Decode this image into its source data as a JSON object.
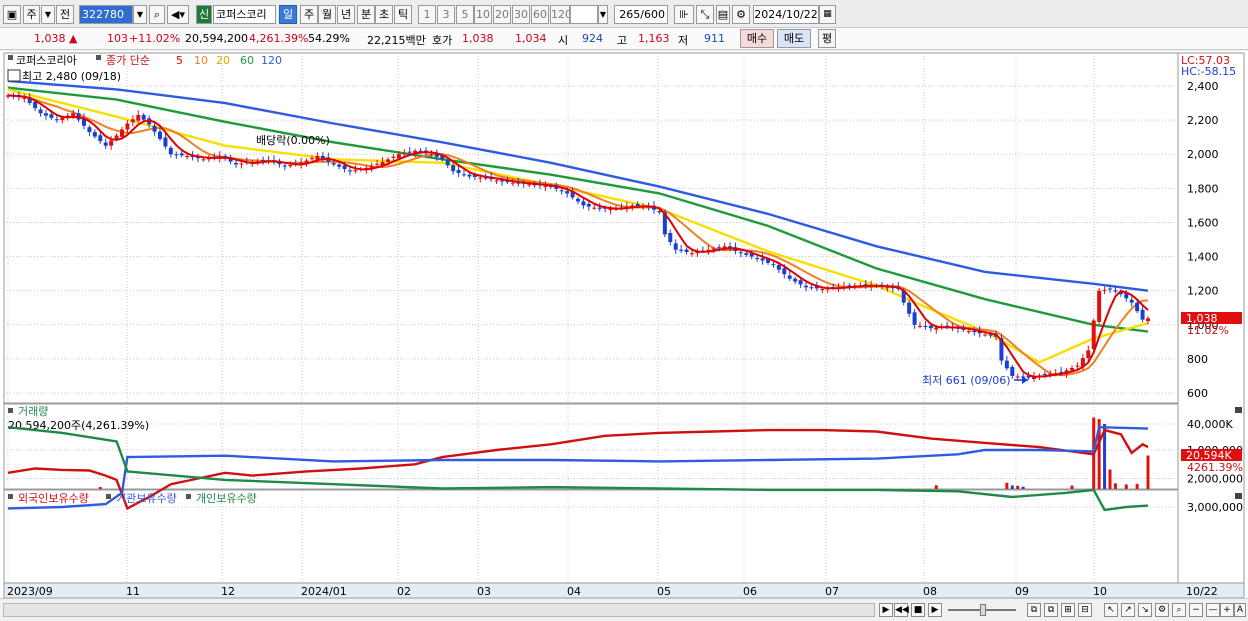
{
  "toolbar": {
    "period_day": "주",
    "prev": "전",
    "code": "322780",
    "new_badge": "신",
    "name": "코퍼스코리",
    "tabs": [
      "일",
      "주",
      "월",
      "년",
      "분",
      "초",
      "틱"
    ],
    "numbers": [
      "1",
      "3",
      "5",
      "10",
      "20",
      "30",
      "60",
      "120"
    ],
    "count": "265",
    "count_total": "/600",
    "date": "2024/10/22"
  },
  "quote": {
    "price": "1,038",
    "up_arrow": "▲",
    "change": "103",
    "change_pct": "+11.02%",
    "volume": "20,594,200",
    "volume_pct": "4,261.39%",
    "ratio": "54.29%",
    "amount": "22,215백만",
    "ask_label": "호가",
    "ask": "1,038",
    "bid": "1,034",
    "open_label": "시",
    "open": "924",
    "high_label": "고",
    "high": "1,163",
    "low_label": "저",
    "low": "911",
    "buy_button": "매수",
    "sell_button": "매도",
    "eval_button": "평"
  },
  "price_pane": {
    "legend_name": "코퍼스코리아",
    "legend_ma": "종가 단순",
    "ma_labels": [
      "5",
      "10",
      "20",
      "60",
      "120"
    ],
    "ma_colors": [
      "#e00000",
      "#f08020",
      "#f5e000",
      "#1f9a3a",
      "#2f5be0"
    ],
    "lc": "LC:57.03",
    "hc": "HC:-58.15",
    "high_note": "최고 2,480 (09/18)",
    "dividend_note": "배당락(0.00%)",
    "low_note": "최저 661 (09/06)",
    "last_price": "1,038",
    "last_pct": "11.02%"
  },
  "volume_pane": {
    "title": "거래량",
    "summary": "20,594,200주(4,261.39%)",
    "tag_value": "20,594K",
    "tag_pct": "4261.39%"
  },
  "holder_pane": {
    "legend": [
      "외국인보유수량",
      "기관보유수량",
      "개인보유수량"
    ],
    "colors": [
      "#d01010",
      "#2f5be0",
      "#1f8a48"
    ]
  },
  "x_axis": [
    "2023/09",
    "11",
    "12",
    "2024/01",
    "02",
    "03",
    "04",
    "05",
    "06",
    "07",
    "08",
    "09",
    "10"
  ],
  "x_axis_end": "10/22",
  "chart_data": [
    {
      "type": "candlestick",
      "title": "",
      "ylim": [
        560,
        2480
      ],
      "yticks": [
        600,
        800,
        1000,
        1200,
        1400,
        1600,
        1800,
        2000,
        2200,
        2400
      ],
      "ytick_labels": [
        "600",
        "800",
        "1,000",
        "1,200",
        "1,400",
        "1,600",
        "1,800",
        "2,000",
        "2,200",
        "2,400"
      ],
      "close_series": [
        [
          0,
          2345
        ],
        [
          3,
          2330
        ],
        [
          6,
          2240
        ],
        [
          9,
          2200
        ],
        [
          12,
          2240
        ],
        [
          15,
          2130
        ],
        [
          18,
          2050
        ],
        [
          20,
          2110
        ],
        [
          22,
          2180
        ],
        [
          24,
          2230
        ],
        [
          26,
          2175
        ],
        [
          28,
          2090
        ],
        [
          30,
          2000
        ],
        [
          33,
          1990
        ],
        [
          36,
          1970
        ],
        [
          39,
          1990
        ],
        [
          42,
          1940
        ],
        [
          45,
          1955
        ],
        [
          48,
          1965
        ],
        [
          51,
          1930
        ],
        [
          54,
          1950
        ],
        [
          57,
          1990
        ],
        [
          60,
          1940
        ],
        [
          63,
          1900
        ],
        [
          66,
          1920
        ],
        [
          69,
          1955
        ],
        [
          72,
          2000
        ],
        [
          75,
          2020
        ],
        [
          78,
          2000
        ],
        [
          80,
          1970
        ],
        [
          82,
          1900
        ],
        [
          85,
          1870
        ],
        [
          88,
          1860
        ],
        [
          91,
          1840
        ],
        [
          94,
          1830
        ],
        [
          97,
          1820
        ],
        [
          100,
          1810
        ],
        [
          103,
          1770
        ],
        [
          106,
          1700
        ],
        [
          109,
          1680
        ],
        [
          112,
          1680
        ],
        [
          115,
          1700
        ],
        [
          118,
          1690
        ],
        [
          120,
          1660
        ],
        [
          121,
          1530
        ],
        [
          123,
          1440
        ],
        [
          126,
          1420
        ],
        [
          129,
          1440
        ],
        [
          132,
          1460
        ],
        [
          135,
          1420
        ],
        [
          138,
          1390
        ],
        [
          141,
          1350
        ],
        [
          144,
          1270
        ],
        [
          147,
          1220
        ],
        [
          150,
          1210
        ],
        [
          153,
          1220
        ],
        [
          156,
          1230
        ],
        [
          159,
          1230
        ],
        [
          162,
          1220
        ],
        [
          164,
          1210
        ],
        [
          165,
          1130
        ],
        [
          167,
          1000
        ],
        [
          170,
          980
        ],
        [
          173,
          990
        ],
        [
          176,
          970
        ],
        [
          179,
          950
        ],
        [
          182,
          930
        ],
        [
          183,
          790
        ],
        [
          185,
          700
        ],
        [
          188,
          690
        ],
        [
          191,
          710
        ],
        [
          194,
          720
        ],
        [
          197,
          760
        ],
        [
          199,
          850
        ],
        [
          201,
          1200
        ],
        [
          203,
          1210
        ],
        [
          205,
          1180
        ],
        [
          207,
          1130
        ],
        [
          209,
          1030
        ],
        [
          210,
          1038
        ]
      ],
      "ma120": [
        [
          0,
          2430
        ],
        [
          20,
          2380
        ],
        [
          40,
          2300
        ],
        [
          60,
          2180
        ],
        [
          80,
          2070
        ],
        [
          100,
          1950
        ],
        [
          120,
          1810
        ],
        [
          140,
          1650
        ],
        [
          160,
          1460
        ],
        [
          180,
          1310
        ],
        [
          200,
          1240
        ],
        [
          210,
          1200
        ]
      ],
      "ma60": [
        [
          0,
          2390
        ],
        [
          20,
          2320
        ],
        [
          40,
          2190
        ],
        [
          60,
          2070
        ],
        [
          80,
          1970
        ],
        [
          100,
          1880
        ],
        [
          120,
          1770
        ],
        [
          140,
          1580
        ],
        [
          160,
          1330
        ],
        [
          180,
          1150
        ],
        [
          200,
          1000
        ],
        [
          210,
          960
        ]
      ],
      "ma20": [
        [
          0,
          2380
        ],
        [
          20,
          2220
        ],
        [
          40,
          2050
        ],
        [
          60,
          1970
        ],
        [
          80,
          1950
        ],
        [
          100,
          1820
        ],
        [
          120,
          1680
        ],
        [
          140,
          1430
        ],
        [
          160,
          1230
        ],
        [
          170,
          1090
        ],
        [
          180,
          960
        ],
        [
          190,
          780
        ],
        [
          200,
          920
        ],
        [
          210,
          1010
        ]
      ]
    },
    {
      "type": "bar",
      "title": "거래량",
      "ylabel": "",
      "yticks": [
        40000
      ],
      "ytick_labels": [
        "40,000K"
      ],
      "bars": [
        [
          17,
          1200
        ],
        [
          171,
          2300
        ],
        [
          184,
          3800
        ],
        [
          185,
          2200
        ],
        [
          186,
          1900
        ],
        [
          187,
          1400
        ],
        [
          196,
          2100
        ],
        [
          200,
          44000
        ],
        [
          201,
          43000
        ],
        [
          202,
          40000
        ],
        [
          203,
          12000
        ],
        [
          204,
          3500
        ],
        [
          206,
          2800
        ],
        [
          208,
          3200
        ],
        [
          210,
          20594
        ]
      ]
    },
    {
      "type": "line",
      "title": "",
      "yticks": [
        1000000,
        2000000,
        3000000
      ],
      "ytick_labels": [
        "1,000,000",
        "2,000,000",
        "3,000,000"
      ],
      "series": [
        {
          "name": "외국인보유수량",
          "points": [
            [
              0,
              1800000
            ],
            [
              5,
              1650000
            ],
            [
              10,
              1700000
            ],
            [
              15,
              1720000
            ],
            [
              18,
              1900000
            ],
            [
              20,
              2050000
            ],
            [
              22,
              3050000
            ],
            [
              26,
              2650000
            ],
            [
              30,
              2200000
            ],
            [
              35,
              2000000
            ],
            [
              40,
              1800000
            ],
            [
              45,
              1900000
            ],
            [
              55,
              1750000
            ],
            [
              65,
              1650000
            ],
            [
              75,
              1500000
            ],
            [
              80,
              1250000
            ],
            [
              90,
              1000000
            ],
            [
              100,
              800000
            ],
            [
              110,
              500000
            ],
            [
              120,
              400000
            ],
            [
              130,
              350000
            ],
            [
              140,
              300000
            ],
            [
              150,
              300000
            ],
            [
              160,
              350000
            ],
            [
              170,
              600000
            ],
            [
              180,
              750000
            ],
            [
              190,
              900000
            ],
            [
              200,
              1150000
            ],
            [
              202,
              300000
            ],
            [
              205,
              450000
            ],
            [
              207,
              1100000
            ],
            [
              209,
              800000
            ],
            [
              210,
              900000
            ]
          ]
        },
        {
          "name": "기관보유수량",
          "points": [
            [
              0,
              3050000
            ],
            [
              10,
              3000000
            ],
            [
              18,
              2900000
            ],
            [
              21,
              2500000
            ],
            [
              22,
              1250000
            ],
            [
              40,
              1200000
            ],
            [
              60,
              1400000
            ],
            [
              80,
              1350000
            ],
            [
              100,
              1350000
            ],
            [
              120,
              1400000
            ],
            [
              140,
              1350000
            ],
            [
              160,
              1300000
            ],
            [
              175,
              1150000
            ],
            [
              180,
              1000000
            ],
            [
              190,
              1000000
            ],
            [
              200,
              1050000
            ],
            [
              201,
              200000
            ],
            [
              210,
              250000
            ]
          ]
        },
        {
          "name": "개인보유수량",
          "points": [
            [
              0,
              200000
            ],
            [
              10,
              400000
            ],
            [
              20,
              700000
            ],
            [
              22,
              1750000
            ],
            [
              40,
              2050000
            ],
            [
              60,
              2200000
            ],
            [
              80,
              2350000
            ],
            [
              100,
              2300000
            ],
            [
              120,
              2350000
            ],
            [
              140,
              2400000
            ],
            [
              160,
              2400000
            ],
            [
              175,
              2450000
            ],
            [
              185,
              2650000
            ],
            [
              195,
              2500000
            ],
            [
              200,
              2400000
            ],
            [
              202,
              3100000
            ],
            [
              206,
              3000000
            ],
            [
              210,
              2950000
            ]
          ]
        }
      ]
    }
  ]
}
